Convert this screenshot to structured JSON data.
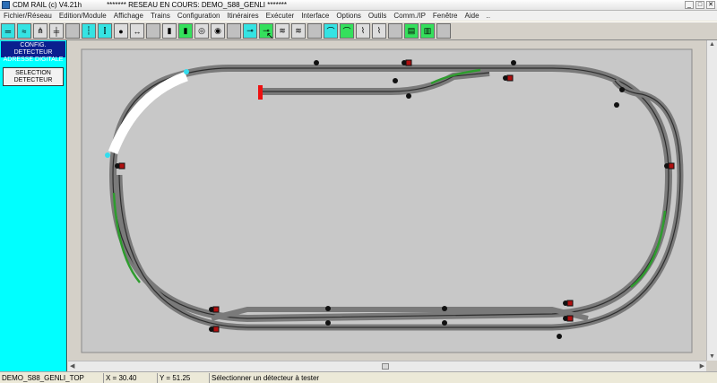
{
  "window": {
    "app_title": "CDM RAIL (c) V4.21h",
    "network_title": "******* RESEAU EN COURS: DEMO_S88_GENLI *******",
    "buttons": [
      "_",
      "□",
      "✕"
    ]
  },
  "menu": [
    "Fichier/Réseau",
    "Edition/Module",
    "Affichage",
    "Trains",
    "Configuration",
    "Itinéraires",
    "Exécuter",
    "Interface",
    "Options",
    "Outils",
    "Comm./IP",
    "Fenêtre",
    "Aide",
    ".."
  ],
  "toolbar_icons": [
    {
      "name": "track-icon",
      "glyph": "═",
      "color": "#35e3e3"
    },
    {
      "name": "track-curve-icon",
      "glyph": "≈",
      "color": "#35e3e3"
    },
    {
      "name": "turnout-icon",
      "glyph": "⋔",
      "color": "#ddd"
    },
    {
      "name": "crossing-icon",
      "glyph": "╪",
      "color": "#ddd"
    },
    {
      "name": "blank-icon",
      "glyph": "",
      "color": "#c0c0c0"
    },
    {
      "name": "signal-icon",
      "glyph": "┆",
      "color": "#35e3e3"
    },
    {
      "name": "signal-double-icon",
      "glyph": "⫿",
      "color": "#35e3e3"
    },
    {
      "name": "signal-red-icon",
      "glyph": "●",
      "color": "#ddd"
    },
    {
      "name": "signal-arrow-icon",
      "glyph": "↔",
      "color": "#ddd"
    },
    {
      "name": "blank-icon",
      "glyph": "",
      "color": "#c0c0c0"
    },
    {
      "name": "light-icon",
      "glyph": "▮",
      "color": "#ddd"
    },
    {
      "name": "signal-green-icon",
      "glyph": "▮",
      "color": "#34e05c"
    },
    {
      "name": "semaphore-icon",
      "glyph": "◎",
      "color": "#ddd"
    },
    {
      "name": "semaphore-red-icon",
      "glyph": "◉",
      "color": "#ddd"
    },
    {
      "name": "blank-icon",
      "glyph": "",
      "color": "#c0c0c0"
    },
    {
      "name": "detector-icon",
      "glyph": "⊸",
      "color": "#35e3e3"
    },
    {
      "name": "detector-test-icon",
      "glyph": "⊸",
      "color": "#34e05c"
    },
    {
      "name": "route-icon",
      "glyph": "≋",
      "color": "#ddd"
    },
    {
      "name": "route-red-icon",
      "glyph": "≋",
      "color": "#ddd"
    },
    {
      "name": "blank-icon",
      "glyph": "",
      "color": "#c0c0c0"
    },
    {
      "name": "level-icon",
      "glyph": "⌒",
      "color": "#35e3e3"
    },
    {
      "name": "level-green-icon",
      "glyph": "⌒",
      "color": "#34e05c"
    },
    {
      "name": "slope-icon",
      "glyph": "⌇",
      "color": "#ddd"
    },
    {
      "name": "slope-green-icon",
      "glyph": "⌇",
      "color": "#ddd"
    },
    {
      "name": "blank-icon",
      "glyph": "",
      "color": "#c0c0c0"
    },
    {
      "name": "train-icon",
      "glyph": "▤",
      "color": "#34e05c"
    },
    {
      "name": "train-run-icon",
      "glyph": "▥",
      "color": "#34e05c"
    },
    {
      "name": "blank-icon",
      "glyph": "",
      "color": "#c0c0c0"
    }
  ],
  "sidebar": {
    "header": "CONFIG. DETECTEUR ADRESSE DIGITALE",
    "button": "SELECTION DETECTEUR"
  },
  "colors": {
    "rail": "#3c3c3c",
    "track_bed": "#7a7a7a",
    "occupied": "#2e9c2e",
    "selected": "#ffffff",
    "buffer": "#ee1111",
    "canvas": "#d4d0c8"
  },
  "status": {
    "network": "DEMO_S88_GENLI_TOP",
    "x_label": "X =",
    "x_value": "30.40",
    "y_label": "Y =",
    "y_value": "51.25",
    "message": "Sélectionner un détecteur à tester"
  }
}
